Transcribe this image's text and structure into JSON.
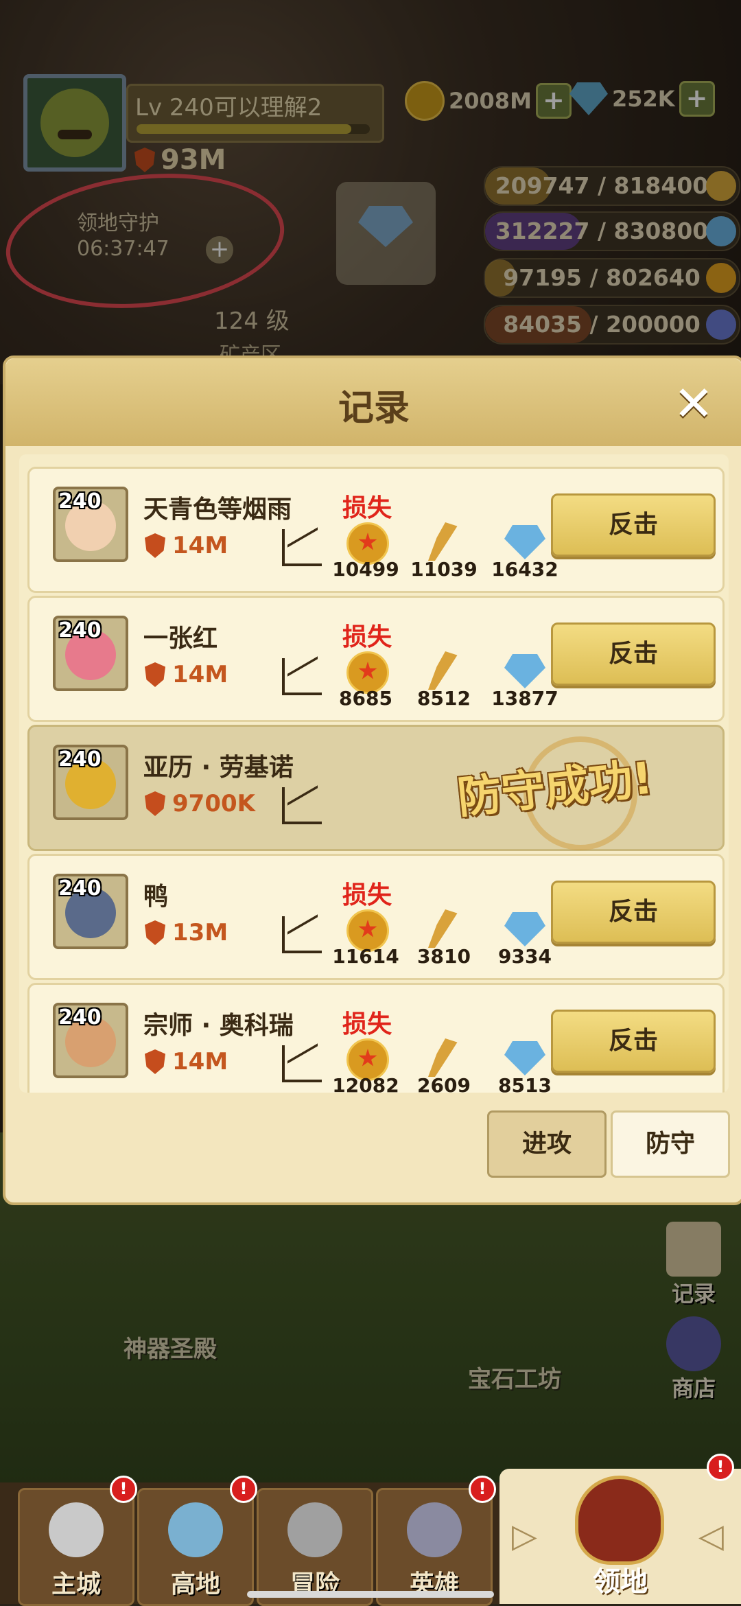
{
  "hud": {
    "player_name": "Lv 240可以理解2",
    "power": "93M",
    "gold": "2008M",
    "diamonds": "252K",
    "guard_label": "领地守护",
    "guard_timer": "06:37:47",
    "level_label": "124 级",
    "mine_label": "矿产区"
  },
  "resources": [
    {
      "text": "209747 / 818400",
      "fill": 0.26,
      "color": "#d7a83a"
    },
    {
      "text": "312227 / 830800",
      "fill": 0.38,
      "color": "#7a48d0"
    },
    {
      "text": "97195 / 802640",
      "fill": 0.12,
      "color": "#d7a83a"
    },
    {
      "text": "84035 / 200000",
      "fill": 0.42,
      "color": "#b05a2a"
    }
  ],
  "modal": {
    "title": "记录",
    "close": "✕"
  },
  "records": [
    {
      "level": "240",
      "name": "天青色等烟雨",
      "power": "14M",
      "result": "损失",
      "coin": "10499",
      "wheat": "11039",
      "gem": "16432",
      "button": "反击",
      "avatar_color": "#f1d0b0"
    },
    {
      "level": "240",
      "name": "一张红",
      "power": "14M",
      "result": "损失",
      "coin": "8685",
      "wheat": "8512",
      "gem": "13877",
      "button": "反击",
      "avatar_color": "#e77a8c"
    },
    {
      "level": "240",
      "name": "亚历 · 劳基诺",
      "power": "9700K",
      "stamp": "防守成功!",
      "avatar_color": "#e0b030"
    },
    {
      "level": "240",
      "name": "鸭",
      "power": "13M",
      "result": "损失",
      "coin": "11614",
      "wheat": "3810",
      "gem": "9334",
      "button": "反击",
      "avatar_color": "#5a6a8a"
    },
    {
      "level": "240",
      "name": "宗师 · 奥科瑞",
      "power": "14M",
      "result": "损失",
      "coin": "12082",
      "wheat": "2609",
      "gem": "8513",
      "button": "反击",
      "avatar_color": "#d8a070"
    }
  ],
  "tabs": {
    "attack": "进攻",
    "defend": "防守"
  },
  "map": {
    "artifact_hall": "神器圣殿",
    "gem_workshop": "宝石工坊",
    "record": "记录",
    "shop": "商店"
  },
  "nav": [
    {
      "label": "主城"
    },
    {
      "label": "高地"
    },
    {
      "label": "冒险"
    },
    {
      "label": "英雄"
    },
    {
      "label": "领地"
    }
  ],
  "alert": "!"
}
